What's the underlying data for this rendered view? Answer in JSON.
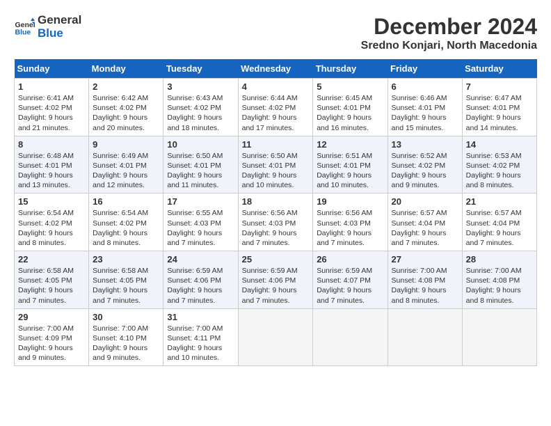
{
  "header": {
    "logo_line1": "General",
    "logo_line2": "Blue",
    "month_year": "December 2024",
    "location": "Sredno Konjari, North Macedonia"
  },
  "days_of_week": [
    "Sunday",
    "Monday",
    "Tuesday",
    "Wednesday",
    "Thursday",
    "Friday",
    "Saturday"
  ],
  "weeks": [
    [
      {
        "day": "1",
        "sunrise": "6:41 AM",
        "sunset": "4:02 PM",
        "daylight": "9 hours and 21 minutes."
      },
      {
        "day": "2",
        "sunrise": "6:42 AM",
        "sunset": "4:02 PM",
        "daylight": "9 hours and 20 minutes."
      },
      {
        "day": "3",
        "sunrise": "6:43 AM",
        "sunset": "4:02 PM",
        "daylight": "9 hours and 18 minutes."
      },
      {
        "day": "4",
        "sunrise": "6:44 AM",
        "sunset": "4:02 PM",
        "daylight": "9 hours and 17 minutes."
      },
      {
        "day": "5",
        "sunrise": "6:45 AM",
        "sunset": "4:01 PM",
        "daylight": "9 hours and 16 minutes."
      },
      {
        "day": "6",
        "sunrise": "6:46 AM",
        "sunset": "4:01 PM",
        "daylight": "9 hours and 15 minutes."
      },
      {
        "day": "7",
        "sunrise": "6:47 AM",
        "sunset": "4:01 PM",
        "daylight": "9 hours and 14 minutes."
      }
    ],
    [
      {
        "day": "8",
        "sunrise": "6:48 AM",
        "sunset": "4:01 PM",
        "daylight": "9 hours and 13 minutes."
      },
      {
        "day": "9",
        "sunrise": "6:49 AM",
        "sunset": "4:01 PM",
        "daylight": "9 hours and 12 minutes."
      },
      {
        "day": "10",
        "sunrise": "6:50 AM",
        "sunset": "4:01 PM",
        "daylight": "9 hours and 11 minutes."
      },
      {
        "day": "11",
        "sunrise": "6:50 AM",
        "sunset": "4:01 PM",
        "daylight": "9 hours and 10 minutes."
      },
      {
        "day": "12",
        "sunrise": "6:51 AM",
        "sunset": "4:01 PM",
        "daylight": "9 hours and 10 minutes."
      },
      {
        "day": "13",
        "sunrise": "6:52 AM",
        "sunset": "4:02 PM",
        "daylight": "9 hours and 9 minutes."
      },
      {
        "day": "14",
        "sunrise": "6:53 AM",
        "sunset": "4:02 PM",
        "daylight": "9 hours and 8 minutes."
      }
    ],
    [
      {
        "day": "15",
        "sunrise": "6:54 AM",
        "sunset": "4:02 PM",
        "daylight": "9 hours and 8 minutes."
      },
      {
        "day": "16",
        "sunrise": "6:54 AM",
        "sunset": "4:02 PM",
        "daylight": "9 hours and 8 minutes."
      },
      {
        "day": "17",
        "sunrise": "6:55 AM",
        "sunset": "4:03 PM",
        "daylight": "9 hours and 7 minutes."
      },
      {
        "day": "18",
        "sunrise": "6:56 AM",
        "sunset": "4:03 PM",
        "daylight": "9 hours and 7 minutes."
      },
      {
        "day": "19",
        "sunrise": "6:56 AM",
        "sunset": "4:03 PM",
        "daylight": "9 hours and 7 minutes."
      },
      {
        "day": "20",
        "sunrise": "6:57 AM",
        "sunset": "4:04 PM",
        "daylight": "9 hours and 7 minutes."
      },
      {
        "day": "21",
        "sunrise": "6:57 AM",
        "sunset": "4:04 PM",
        "daylight": "9 hours and 7 minutes."
      }
    ],
    [
      {
        "day": "22",
        "sunrise": "6:58 AM",
        "sunset": "4:05 PM",
        "daylight": "9 hours and 7 minutes."
      },
      {
        "day": "23",
        "sunrise": "6:58 AM",
        "sunset": "4:05 PM",
        "daylight": "9 hours and 7 minutes."
      },
      {
        "day": "24",
        "sunrise": "6:59 AM",
        "sunset": "4:06 PM",
        "daylight": "9 hours and 7 minutes."
      },
      {
        "day": "25",
        "sunrise": "6:59 AM",
        "sunset": "4:06 PM",
        "daylight": "9 hours and 7 minutes."
      },
      {
        "day": "26",
        "sunrise": "6:59 AM",
        "sunset": "4:07 PM",
        "daylight": "9 hours and 7 minutes."
      },
      {
        "day": "27",
        "sunrise": "7:00 AM",
        "sunset": "4:08 PM",
        "daylight": "9 hours and 8 minutes."
      },
      {
        "day": "28",
        "sunrise": "7:00 AM",
        "sunset": "4:08 PM",
        "daylight": "9 hours and 8 minutes."
      }
    ],
    [
      {
        "day": "29",
        "sunrise": "7:00 AM",
        "sunset": "4:09 PM",
        "daylight": "9 hours and 9 minutes."
      },
      {
        "day": "30",
        "sunrise": "7:00 AM",
        "sunset": "4:10 PM",
        "daylight": "9 hours and 9 minutes."
      },
      {
        "day": "31",
        "sunrise": "7:00 AM",
        "sunset": "4:11 PM",
        "daylight": "9 hours and 10 minutes."
      },
      null,
      null,
      null,
      null
    ]
  ],
  "labels": {
    "sunrise_prefix": "Sunrise: ",
    "sunset_prefix": "Sunset: ",
    "daylight_prefix": "Daylight: "
  }
}
